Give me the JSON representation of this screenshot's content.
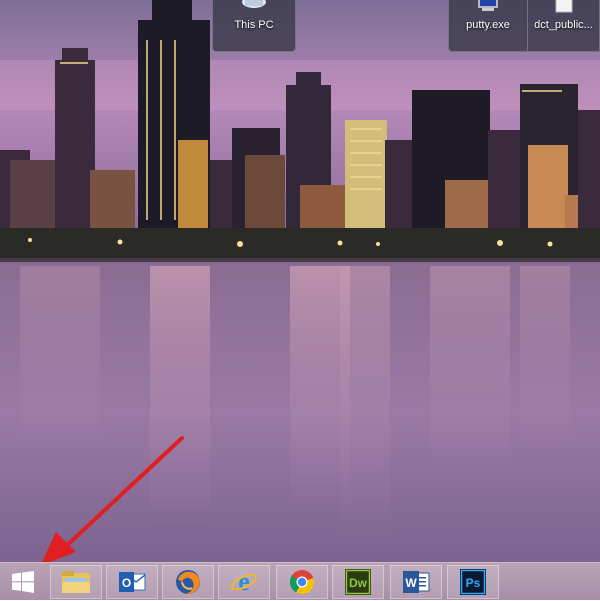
{
  "desktop": {
    "shortcuts": [
      {
        "label": "This PC",
        "icon": "computer-icon"
      },
      {
        "label": "putty.exe",
        "icon": "putty-icon"
      },
      {
        "label": "dct_public...",
        "icon": "file-icon"
      }
    ]
  },
  "taskbar": {
    "start": {
      "icon": "windows-logo-icon"
    },
    "apps": [
      {
        "name": "File Explorer",
        "icon": "folder-icon"
      },
      {
        "name": "Outlook",
        "icon": "outlook-icon",
        "glyph": "O"
      },
      {
        "name": "Firefox",
        "icon": "firefox-icon"
      },
      {
        "name": "Internet Explorer",
        "icon": "ie-icon",
        "glyph": "e"
      },
      {
        "name": "Chrome",
        "icon": "chrome-icon"
      },
      {
        "name": "Dreamweaver",
        "icon": "dreamweaver-icon",
        "glyph": "Dw"
      },
      {
        "name": "Word",
        "icon": "word-icon",
        "glyph": "W"
      },
      {
        "name": "Photoshop",
        "icon": "photoshop-icon",
        "glyph": "Ps"
      }
    ]
  },
  "colors": {
    "arrow": "#e02020",
    "taskbar": "#b19aaf"
  }
}
